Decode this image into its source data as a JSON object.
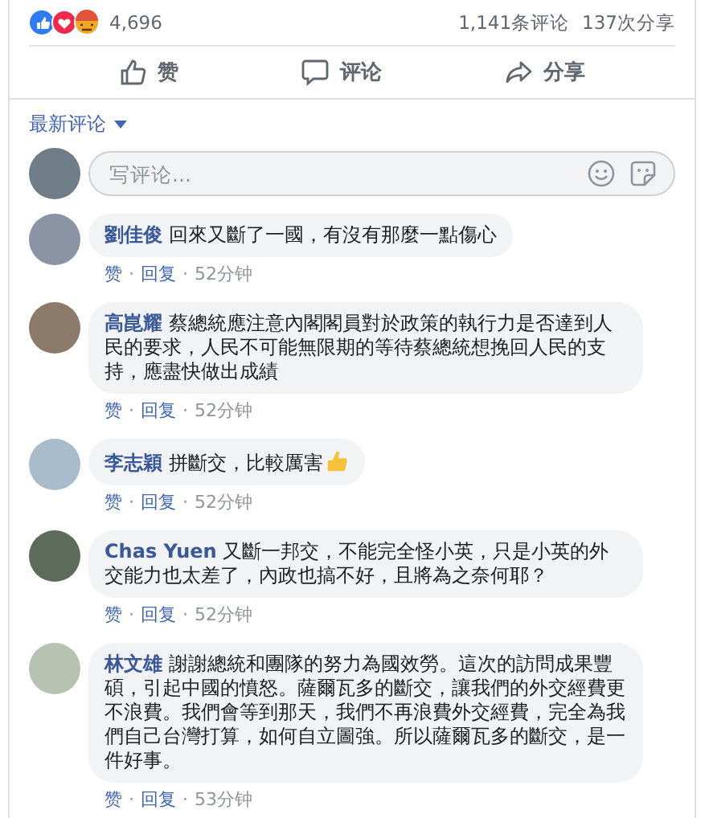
{
  "reactions": {
    "count": "4,696",
    "comments_count": "1,141条评论",
    "shares_count": "137次分享"
  },
  "actions": [
    {
      "kind": "like",
      "label": "赞"
    },
    {
      "kind": "comment",
      "label": "评论"
    },
    {
      "kind": "share",
      "label": "分享"
    }
  ],
  "sort": {
    "label": "最新评论"
  },
  "composer": {
    "placeholder": "写评论..."
  },
  "comments": [
    {
      "author": "劉佳俊",
      "text": "回來又斷了一國，有沒有那麼一點傷心",
      "thumb_emoji": false,
      "like": "赞",
      "separator_1": "·",
      "reply": "回复",
      "separator_2": "·",
      "time": "52分钟"
    },
    {
      "author": "高崑耀",
      "text": "蔡總統應注意內閣閣員對於政策的執行力是否達到人民的要求，人民不可能無限期的等待蔡總統想挽回人民的支持，應盡快做出成績",
      "thumb_emoji": false,
      "like": "赞",
      "separator_1": "·",
      "reply": "回复",
      "separator_2": "·",
      "time": "52分钟"
    },
    {
      "author": "李志穎",
      "text": "拼斷交，比較厲害",
      "thumb_emoji": true,
      "like": "赞",
      "separator_1": "·",
      "reply": "回复",
      "separator_2": "·",
      "time": "52分钟"
    },
    {
      "author": "Chas Yuen",
      "text": "又斷一邦交，不能完全怪小英，只是小英的外交能力也太差了，內政也搞不好，且將為之奈何耶？",
      "thumb_emoji": false,
      "like": "赞",
      "separator_1": "·",
      "reply": "回复",
      "separator_2": "·",
      "time": "52分钟"
    },
    {
      "author": "林文雄",
      "text": "謝謝總統和團隊的努力為國效勞。這次的訪問成果豐碩，引起中國的憤怒。薩爾瓦多的斷交，讓我們的外交經費更不浪費。我們會等到那天，我們不再浪費外交經費，完全為我們自己台灣打算，如何自立圖強。所以薩爾瓦多的斷交，是一件好事。",
      "thumb_emoji": false,
      "like": "赞",
      "separator_1": "·",
      "reply": "回复",
      "separator_2": "·",
      "time": "53分钟"
    }
  ]
}
